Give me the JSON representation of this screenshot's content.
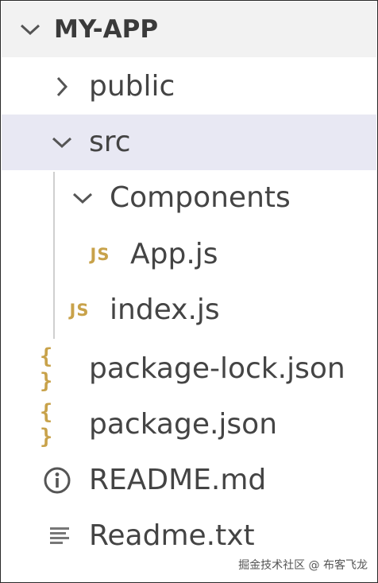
{
  "explorer": {
    "root": {
      "label": "MY-APP",
      "icon": "chevron-down-icon"
    },
    "items": [
      {
        "label": "public",
        "icon": "chevron-right-icon",
        "state": "collapsed"
      },
      {
        "label": "src",
        "icon": "chevron-down-icon",
        "state": "expanded",
        "selected": true
      },
      {
        "label": "Components",
        "icon": "chevron-down-icon",
        "state": "expanded"
      },
      {
        "label": "App.js",
        "icon": "js-file-icon",
        "icon_text": "JS"
      },
      {
        "label": "index.js",
        "icon": "js-file-icon",
        "icon_text": "JS"
      },
      {
        "label": "package-lock.json",
        "icon": "json-file-icon",
        "icon_text": "{ }"
      },
      {
        "label": "package.json",
        "icon": "json-file-icon",
        "icon_text": "{ }"
      },
      {
        "label": "README.md",
        "icon": "info-icon"
      },
      {
        "label": "Readme.txt",
        "icon": "text-lines-icon"
      }
    ]
  },
  "watermark": "掘金技术社区 @ 布客飞龙",
  "colors": {
    "header_bg": "#f2f2f2",
    "selected_bg": "#e8e8f3",
    "text": "#444444",
    "js_icon": "#c8a24a",
    "json_icon": "#c8a24a",
    "info_icon": "#555555"
  }
}
